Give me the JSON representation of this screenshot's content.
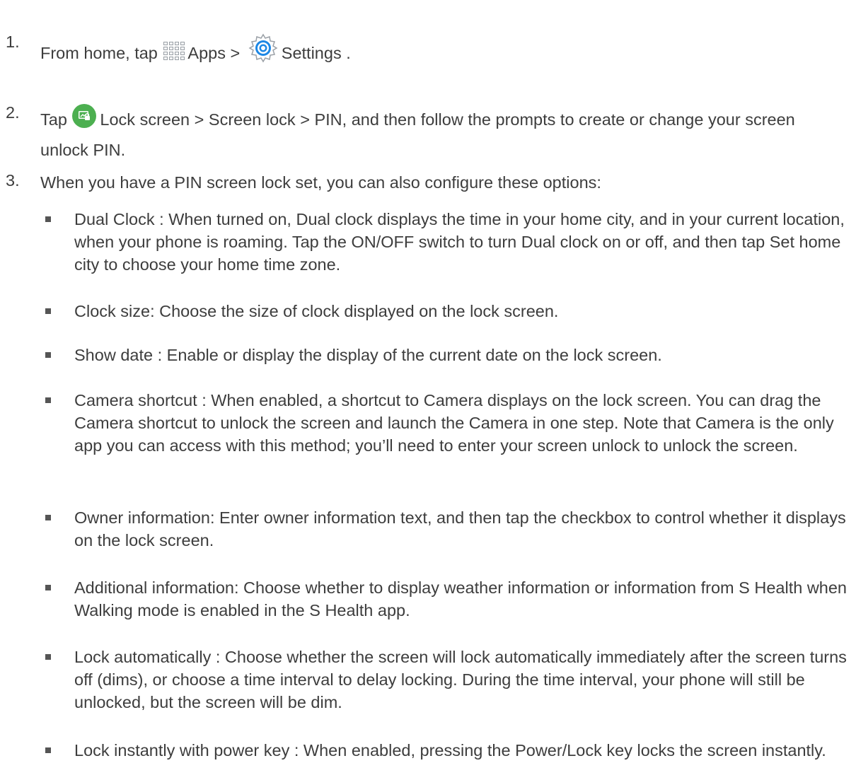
{
  "steps": [
    {
      "number": "1.",
      "part1": "From home, tap",
      "apps_label": "Apps",
      "sep": ">",
      "settings_label": "Settings",
      "end": "."
    },
    {
      "number": "2.",
      "part1": "Tap",
      "text": "Lock screen   > Screen lock   > PIN, and then follow the prompts to create or change your screen unlock PIN."
    },
    {
      "number": "3.",
      "text": "When you have a PIN screen lock set, you can also configure these options:"
    }
  ],
  "options": [
    "Dual Clock : When turned on, Dual clock displays the time in your home city, and in your current location, when your phone is roaming. Tap the ON/OFF switch to turn Dual clock on or off, and then tap Set home city   to choose your home time zone.",
    "Clock size:  Choose the size of clock displayed on the lock screen.",
    "Show date : Enable or display the display of the current date on the lock screen.",
    "Camera shortcut  : When enabled, a shortcut to Camera displays on the lock screen. You can drag the Camera shortcut to unlock the screen and launch the Camera in one step. Note that Camera is the only app you can access with this method; you’ll need to enter your screen unlock to unlock the screen.",
    "Owner information:   Enter owner information text, and then tap the checkbox to control whether it displays on the lock screen.",
    "Additional information:     Choose whether to display weather information or information from S Health when Walking mode is enabled in the S Health app.",
    "Lock automatically   : Choose whether the screen will lock automatically immediately after the screen turns off (dims), or choose a time interval to delay locking. During the time interval, your phone will still be unlocked, but the screen will be dim.",
    "Lock instantly with power key    : When enabled, pressing the Power/Lock key locks the screen instantly."
  ],
  "colors": {
    "text": "#3d3d3d",
    "lock_icon": "#4caf50",
    "gear_icon": "#1e88e5"
  },
  "icons": {
    "apps": "apps-grid-icon",
    "settings": "gear-icon",
    "lock_screen": "lock-screen-icon"
  }
}
